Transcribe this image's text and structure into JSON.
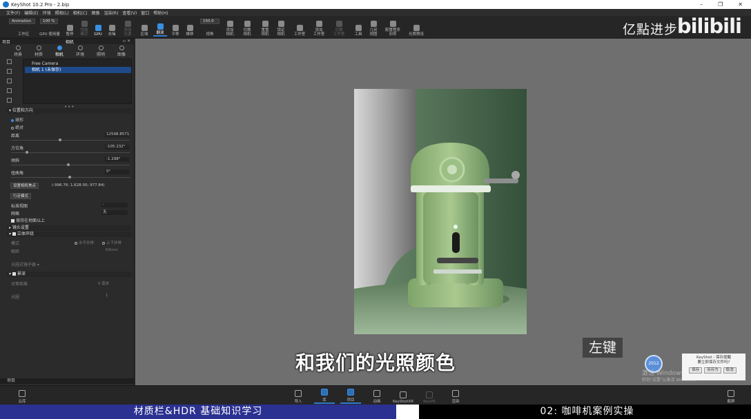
{
  "window": {
    "title": "KeyShot 10.2 Pro - 2.bip",
    "controls": [
      "–",
      "❐",
      "✕"
    ]
  },
  "menu": [
    "文件(F)",
    "编辑(E)",
    "环境",
    "照相(L)",
    "相机(C)",
    "图像",
    "渲染(R)",
    "查看(V)",
    "窗口",
    "帮助(H)"
  ],
  "toolbar": {
    "workspace_value": "Animation",
    "zoom_value": "100 %",
    "cpu_gpu_label": "GPU 使用量",
    "fov_value": "150.0",
    "buttons": [
      {
        "label": "工作区",
        "name": "workspace-button"
      },
      {
        "label": "GPU 使用量",
        "name": "gpu-usage-button"
      },
      {
        "label": "暂停",
        "name": "pause-button"
      },
      {
        "label": "性能\n模式",
        "name": "performance-mode-button"
      },
      {
        "label": "GPU",
        "name": "gpu-button"
      },
      {
        "label": "去噪",
        "name": "denoise-button"
      },
      {
        "label": "添加\n光源",
        "name": "add-light-button"
      },
      {
        "label": "区域",
        "name": "region-button"
      },
      {
        "label": "翻滚",
        "name": "tumble-button"
      },
      {
        "label": "平移",
        "name": "pan-button"
      },
      {
        "label": "推移",
        "name": "dolly-button"
      },
      {
        "label": "视角",
        "name": "perspective-button"
      },
      {
        "label": "添加\n相机",
        "name": "add-camera-button"
      },
      {
        "label": "切换\n相机",
        "name": "switch-camera-button"
      },
      {
        "label": "重置\n相机",
        "name": "reset-camera-button"
      },
      {
        "label": "锁定\n相机",
        "name": "lock-camera-button"
      },
      {
        "label": "工作室",
        "name": "studio-button"
      },
      {
        "label": "添加\n工作室",
        "name": "add-studio-button"
      },
      {
        "label": "切换\n工作室",
        "name": "switch-studio-button"
      },
      {
        "label": "工具",
        "name": "tools-button"
      },
      {
        "label": "几何\n视图",
        "name": "geometry-view-button"
      },
      {
        "label": "配置程序\n向导",
        "name": "configurator-wizard-button"
      },
      {
        "label": "光照预设",
        "name": "lighting-presets-button"
      }
    ]
  },
  "brand": {
    "text": "亿點进步",
    "bilibili": "bilibili"
  },
  "left_panel": {
    "header_left": "项目",
    "header_title": "相机",
    "tabs": [
      "场景",
      "材质",
      "相机",
      "环境",
      "照明",
      "图像"
    ],
    "tree": [
      "Free Camera",
      "相机 1 (未保存)"
    ],
    "section_position": "位置和方向",
    "mode_options": [
      "球形",
      "绝对"
    ],
    "fields": [
      {
        "label": "距离",
        "value": "12598.8571"
      },
      {
        "label": "方位角",
        "value": "-105.232°"
      },
      {
        "label": "倾斜",
        "value": "-1.298°"
      },
      {
        "label": "扭曲角",
        "value": "0°"
      }
    ],
    "set_lookat_button": "设置相机焦点",
    "lookat_value": "(-996.76; 1,628.00; 977.84)",
    "walk_mode_button": "行走模式",
    "standard_view_label": "标准视图",
    "standard_view_value": "-",
    "grid_label": "网格",
    "grid_value": "无",
    "keep_above_ground": "保持在地面以上",
    "lens_section": "镜头设置",
    "stereo_section": "立体环绕",
    "stereo_mode_label": "模式",
    "stereo_options": [
      "水平并排",
      "上下并排"
    ],
    "eye_distance_label": "眼距",
    "eye_distance_value": "63mm",
    "lens_shift_button": "光圈式镜子器",
    "depth_section": "景深",
    "focus_distance_label": "对焦距离",
    "focus_value": "0 毫米",
    "aperture_label": "光圈",
    "aperture_value": "1"
  },
  "status_bar": "项目",
  "subtitle": "和我们的光照颜色",
  "key_hint": "左键",
  "badge": "2012",
  "windows_watermark": [
    "激活 Windows",
    "转到\"设置\"以激活 Windows。"
  ],
  "dialog": {
    "title": "KeyShot - 保存提醒",
    "message": "要立即保存文件吗?",
    "buttons": [
      "保存",
      "另存为",
      "取消"
    ]
  },
  "bottom": {
    "left_button": "云库",
    "buttons": [
      "导入",
      "库",
      "项目",
      "动画",
      "KeyShotXR",
      "KeyVR",
      "渲染"
    ],
    "right_button": "截屏"
  },
  "course_bar": {
    "left": "材质栏&HDR 基础知识学习",
    "right": "02: 咖啡机案例实操"
  },
  "colors": {
    "accent": "#2d7cd1",
    "course_left": "#2b3190",
    "viewport": "#6f6f6f"
  }
}
